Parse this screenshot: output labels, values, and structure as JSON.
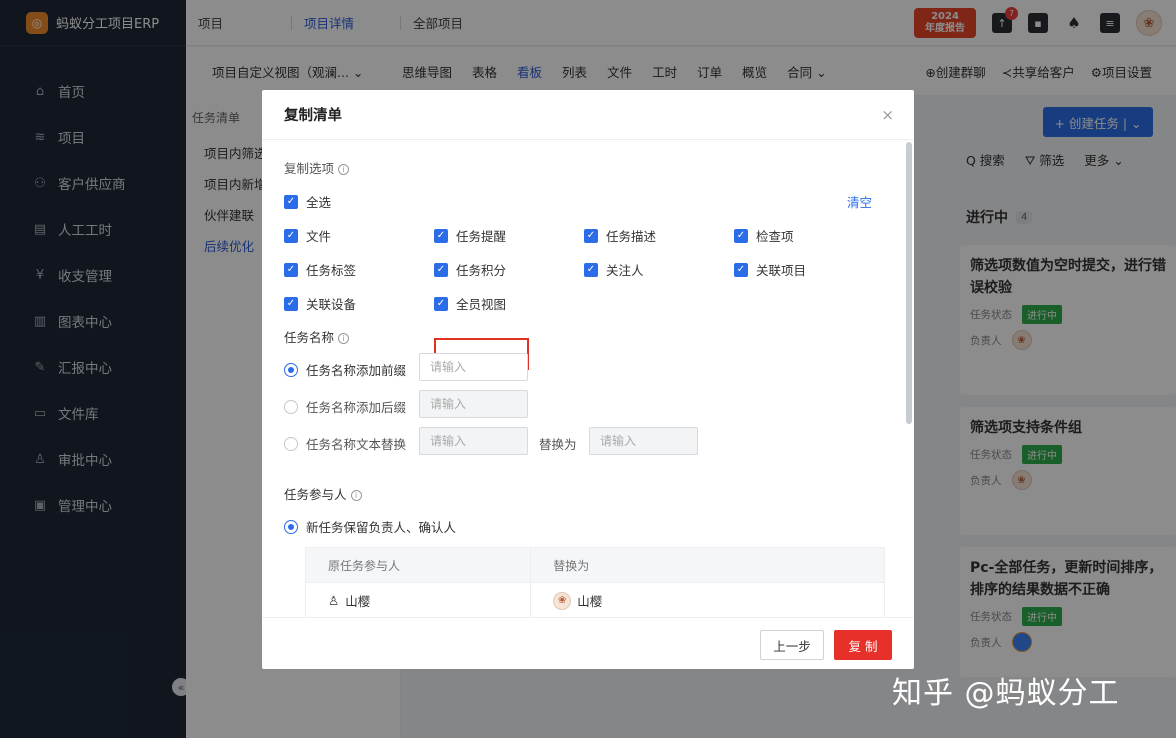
{
  "sidebar": {
    "brand": "蚂蚁分工项目ERP",
    "logo_glyph": "◎",
    "items": [
      {
        "label": "首页",
        "icon": "home-icon",
        "glyph": "⌂"
      },
      {
        "label": "项目",
        "icon": "layers-icon",
        "glyph": "≋"
      },
      {
        "label": "客户供应商",
        "icon": "users-icon",
        "glyph": "⚇"
      },
      {
        "label": "人工工时",
        "icon": "timesheet-icon",
        "glyph": "▤"
      },
      {
        "label": "收支管理",
        "icon": "finance-icon",
        "glyph": "¥"
      },
      {
        "label": "图表中心",
        "icon": "chart-icon",
        "glyph": "▥"
      },
      {
        "label": "汇报中心",
        "icon": "report-icon",
        "glyph": "✎"
      },
      {
        "label": "文件库",
        "icon": "folder-icon",
        "glyph": "▭"
      },
      {
        "label": "审批中心",
        "icon": "approval-icon",
        "glyph": "♙"
      },
      {
        "label": "管理中心",
        "icon": "admin-icon",
        "glyph": "▣"
      }
    ],
    "collapse_glyph": "«"
  },
  "topbar": {
    "crumbs": [
      "项目",
      "项目详情",
      "全部项目"
    ],
    "report_line1": "2024",
    "report_line2": "年度报告",
    "notification_count": "7",
    "icons": {
      "upload": "↑",
      "calendar": "▪",
      "bell": "♠",
      "list": "≡"
    },
    "avatar_glyph": "❀"
  },
  "viewbar": {
    "view_select": "项目自定义视图（观澜...  ⌄",
    "tabs": [
      "思维导图",
      "表格",
      "看板",
      "列表",
      "文件",
      "工时",
      "订单",
      "概览",
      "合同 ⌄"
    ],
    "active_tab": "看板",
    "actions": [
      "⊕创建群聊",
      "≺共享给客户",
      "⚙项目设置"
    ]
  },
  "tasklist": {
    "header": "任务清单",
    "items": [
      "项目内筛选",
      "项目内新增",
      "伙伴建联",
      "后续优化"
    ]
  },
  "board": {
    "create_button": "+ 创建任务  | ⌄",
    "tools": [
      "Q 搜索",
      "⛛ 筛选",
      "更多 ⌄"
    ],
    "column_title": "进行中",
    "column_count": "4",
    "status_label": "任务状态",
    "owner_label": "负责人",
    "status_value": "进行中",
    "cards": [
      {
        "title": "筛选项数值为空时提交，进行错误校验"
      },
      {
        "title": "筛选项支持条件组"
      },
      {
        "title": "Pc-全部任务，更新时间排序，排序的结果数据不正确"
      }
    ]
  },
  "modal": {
    "title": "复制清单",
    "close_glyph": "×",
    "copy_options_label": "复制选项",
    "select_all": "全选",
    "clear": "清空",
    "options": [
      "文件",
      "任务提醒",
      "任务描述",
      "检查项",
      "任务标签",
      "任务积分",
      "关注人",
      "关联项目",
      "关联设备",
      "全员视图"
    ],
    "task_name_label": "任务名称",
    "name_radios": [
      "任务名称添加前缀",
      "任务名称添加后缀",
      "任务名称文本替换"
    ],
    "input_placeholder": "请输入",
    "replace_with": "替换为",
    "participants_label": "任务参与人",
    "participants_radio": "新任务保留负责人、确认人",
    "table_headers": [
      "原任务参与人",
      "替换为"
    ],
    "table_row": {
      "original": "山樱",
      "replacement": "山樱"
    },
    "prev_button": "上一步",
    "copy_button": "复 制"
  },
  "watermark": "知乎 @蚂蚁分工"
}
